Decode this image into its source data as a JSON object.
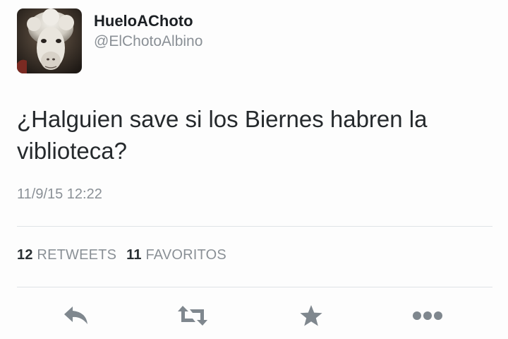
{
  "user": {
    "display_name": "HueloAChoto",
    "handle": "@ElChotoAlbino",
    "avatar_icon": "alpaca-avatar"
  },
  "tweet": {
    "text": "¿Halguien save si los Biernes habren la viblioteca?",
    "timestamp": "11/9/15 12:22"
  },
  "stats": {
    "retweets_count": "12",
    "retweets_label": "RETWEETS",
    "favorites_count": "11",
    "favorites_label": "FAVORITOS"
  },
  "actions": {
    "reply_icon": "reply-icon",
    "retweet_icon": "retweet-icon",
    "favorite_icon": "star-icon",
    "more_icon": "more-dots-icon"
  },
  "colors": {
    "text": "#25292c",
    "muted": "#8a9096",
    "icon": "#7f878e",
    "divider": "#dfe3e6"
  }
}
